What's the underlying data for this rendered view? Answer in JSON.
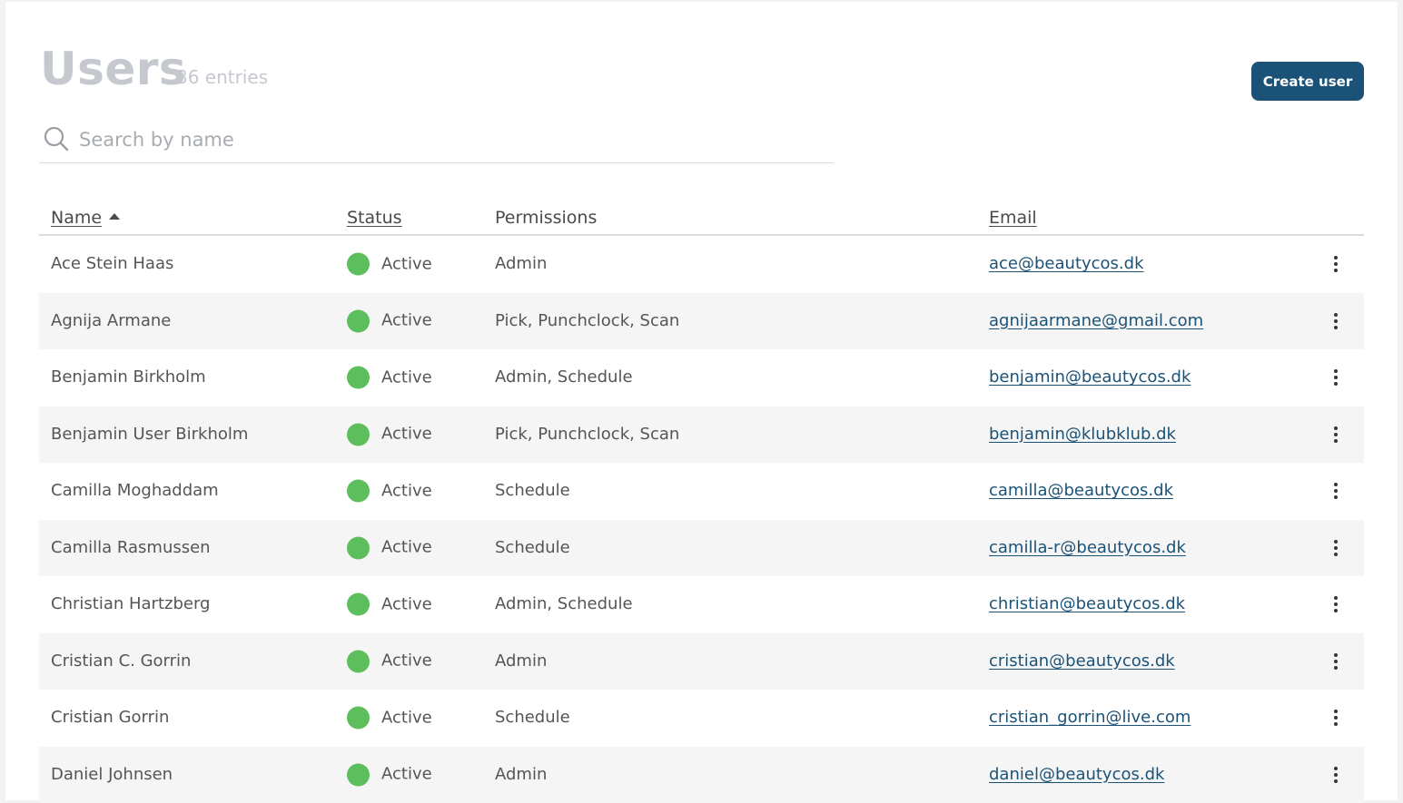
{
  "page": {
    "title": "Users",
    "entries_count": "36 entries",
    "create_button_label": "Create user"
  },
  "search": {
    "placeholder": "Search by name",
    "value": "",
    "icon": "search-icon"
  },
  "table": {
    "columns": {
      "name": "Name",
      "status": "Status",
      "permissions": "Permissions",
      "email": "Email"
    },
    "sort": {
      "column": "name",
      "direction": "ascending"
    },
    "status_color": "#5cbe5c",
    "rows": [
      {
        "name": "Ace Stein Haas",
        "status": "Active",
        "permissions": "Admin",
        "email": "ace@beautycos.dk"
      },
      {
        "name": "Agnija Armane",
        "status": "Active",
        "permissions": "Pick, Punchclock, Scan",
        "email": "agnijaarmane@gmail.com"
      },
      {
        "name": "Benjamin Birkholm",
        "status": "Active",
        "permissions": "Admin, Schedule",
        "email": "benjamin@beautycos.dk"
      },
      {
        "name": "Benjamin User Birkholm",
        "status": "Active",
        "permissions": "Pick, Punchclock, Scan",
        "email": "benjamin@klubklub.dk"
      },
      {
        "name": "Camilla Moghaddam",
        "status": "Active",
        "permissions": "Schedule",
        "email": "camilla@beautycos.dk"
      },
      {
        "name": "Camilla Rasmussen",
        "status": "Active",
        "permissions": "Schedule",
        "email": "camilla-r@beautycos.dk"
      },
      {
        "name": "Christian Hartzberg",
        "status": "Active",
        "permissions": "Admin, Schedule",
        "email": "christian@beautycos.dk"
      },
      {
        "name": "Cristian C. Gorrin",
        "status": "Active",
        "permissions": "Admin",
        "email": "cristian@beautycos.dk"
      },
      {
        "name": "Cristian Gorrin",
        "status": "Active",
        "permissions": "Schedule",
        "email": "cristian_gorrin@live.com"
      },
      {
        "name": "Daniel Johnsen",
        "status": "Active",
        "permissions": "Admin",
        "email": "daniel@beautycos.dk"
      }
    ]
  }
}
